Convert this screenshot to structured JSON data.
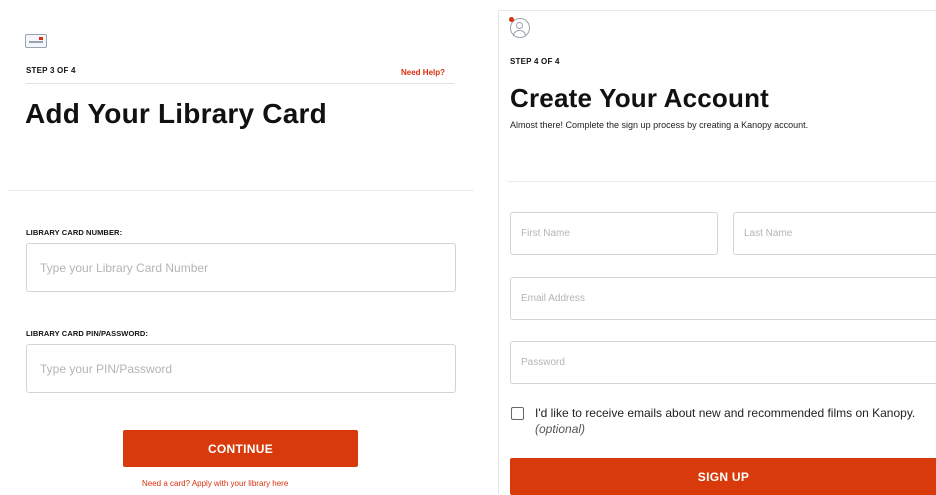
{
  "left_panel": {
    "step": "STEP 3 OF 4",
    "help_link": "Need Help?",
    "title": "Add Your Library Card",
    "card_number_label": "LIBRARY CARD NUMBER:",
    "card_number_placeholder": "Type your Library Card Number",
    "pin_label": "LIBRARY CARD PIN/PASSWORD:",
    "pin_placeholder": "Type your PIN/Password",
    "continue_label": "CONTINUE",
    "apply_link": "Need a card? Apply with your library here",
    "icon": "library-card-icon"
  },
  "right_panel": {
    "step": "STEP 4 OF 4",
    "title": "Create Your Account",
    "subtitle": "Almost there! Complete the sign up process by creating a Kanopy account.",
    "first_name_placeholder": "First Name",
    "last_name_placeholder": "Last Name",
    "email_placeholder": "Email Address",
    "password_placeholder": "Password",
    "consent_text": "I'd like to receive emails about new and recommended films on Kanopy.",
    "consent_optional": "(optional)",
    "signup_label": "SIGN UP",
    "icon": "user-account-icon"
  },
  "colors": {
    "accent": "#d93a0b",
    "link": "#d9300f",
    "border": "#d4d4d4",
    "placeholder": "#b4b4b4"
  }
}
